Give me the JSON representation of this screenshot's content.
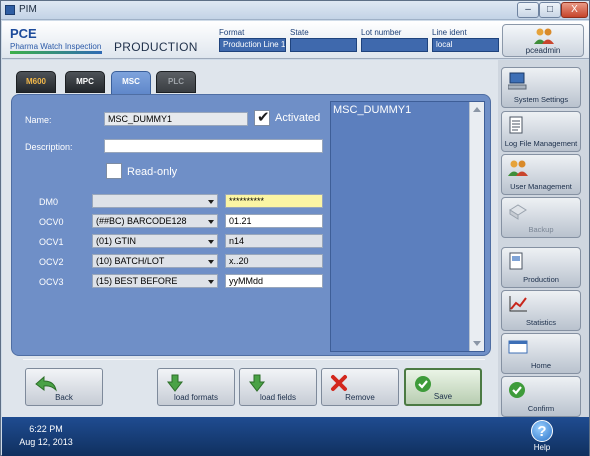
{
  "window": {
    "title": "PIM",
    "min_label": "–",
    "max_label": "□",
    "close_label": "X"
  },
  "header": {
    "logo": "PCE",
    "logo_sub": "Pharma Watch Inspection",
    "page_title": "PRODUCTION",
    "format_label": "Format",
    "format_value": "Production Line 1",
    "state_label": "State",
    "state_value": "",
    "lot_label": "Lot number",
    "lot_value": "",
    "line_label": "Line ident",
    "line_value": "local",
    "user_label": "pceadmin"
  },
  "tabs": [
    {
      "label": "M600"
    },
    {
      "label": "MPC"
    },
    {
      "label": "MSC"
    },
    {
      "label": "PLC"
    }
  ],
  "form": {
    "name_label": "Name:",
    "name_value": "MSC_DUMMY1",
    "activated_label": "Activated",
    "description_label": "Description:",
    "description_value": "",
    "readonly_label": "Read-only",
    "rows": [
      {
        "label": "DM0",
        "select": "",
        "value": "**********"
      },
      {
        "label": "OCV0",
        "select": "(##BC) BARCODE128",
        "value": "01.21"
      },
      {
        "label": "OCV1",
        "select": "(01) GTIN",
        "value": "n14"
      },
      {
        "label": "OCV2",
        "select": "(10) BATCH/LOT",
        "value": "x..20"
      },
      {
        "label": "OCV3",
        "select": "(15) BEST BEFORE",
        "value": "yyMMdd"
      }
    ]
  },
  "list": {
    "items": [
      "MSC_DUMMY1"
    ]
  },
  "buttons": {
    "back": "Back",
    "load_formats": "load formats",
    "load_fields": "load fields",
    "remove": "Remove",
    "save": "Save"
  },
  "sidebar": {
    "items": [
      {
        "label": "System Settings"
      },
      {
        "label": "Log File Management"
      },
      {
        "label": "User Management"
      },
      {
        "label": "Backup"
      },
      {
        "label": "Production"
      },
      {
        "label": "Statistics"
      },
      {
        "label": "Home"
      },
      {
        "label": "Confirm"
      }
    ]
  },
  "footer": {
    "time": "6:22 PM",
    "date": "Aug 12, 2013",
    "help_icon": "?",
    "help_label": "Help"
  },
  "colors": {
    "panel": "#6f8fc7",
    "listbox": "#5c7fbe",
    "header_field": "#3f69ad",
    "footer": "#1f4c91",
    "highlight_field": "#fbf5a4"
  }
}
